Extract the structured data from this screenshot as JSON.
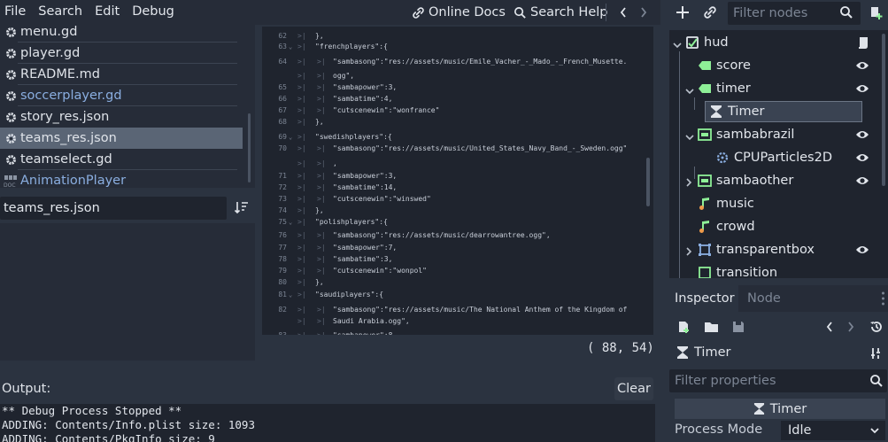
{
  "menu": {
    "file": "File",
    "search": "Search",
    "edit": "Edit",
    "debug": "Debug",
    "online_docs": "Online Docs",
    "search_help": "Search Help"
  },
  "files": [
    {
      "name": "menu.gd",
      "type": "script",
      "link": false
    },
    {
      "name": "player.gd",
      "type": "script",
      "link": false
    },
    {
      "name": "README.md",
      "type": "text",
      "link": false
    },
    {
      "name": "soccerplayer.gd",
      "type": "script",
      "link": true
    },
    {
      "name": "story_res.json",
      "type": "script",
      "link": false
    },
    {
      "name": "teams_res.json",
      "type": "script",
      "link": false,
      "selected": true
    },
    {
      "name": "teamselect.gd",
      "type": "script",
      "link": false
    },
    {
      "name": "AnimationPlayer",
      "type": "doc",
      "link": true
    }
  ],
  "current_file": "teams_res.json",
  "code_lines": [
    {
      "n": "62",
      "fold": "",
      "indent": 0,
      "text": "},"
    },
    {
      "n": "63",
      "fold": "v",
      "indent": 0,
      "text": "\"frenchplayers\":{"
    },
    {
      "n": "64",
      "fold": "",
      "indent": 1,
      "text": "\"sambasong\":\"res://assets/music/Emile_Vacher_-_Mado_-_French_Musette."
    },
    {
      "n": "",
      "fold": "",
      "indent": 1,
      "text": "ogg\","
    },
    {
      "n": "65",
      "fold": "",
      "indent": 1,
      "text": "\"sambapower\":3,"
    },
    {
      "n": "66",
      "fold": "",
      "indent": 1,
      "text": "\"sambatime\":4,"
    },
    {
      "n": "67",
      "fold": "",
      "indent": 1,
      "text": "\"cutscenewin\":\"wonfrance\""
    },
    {
      "n": "68",
      "fold": "",
      "indent": 0,
      "text": "},"
    },
    {
      "n": "69",
      "fold": "v",
      "indent": 0,
      "text": "\"swedishplayers\":{"
    },
    {
      "n": "70",
      "fold": "",
      "indent": 1,
      "text": "\"sambasong\":\"res://assets/music/United_States_Navy_Band_-_Sweden.ogg\""
    },
    {
      "n": "",
      "fold": "",
      "indent": 1,
      "text": ","
    },
    {
      "n": "71",
      "fold": "",
      "indent": 1,
      "text": "\"sambapower\":3,"
    },
    {
      "n": "72",
      "fold": "",
      "indent": 1,
      "text": "\"sambatime\":14,"
    },
    {
      "n": "73",
      "fold": "",
      "indent": 1,
      "text": "\"cutscenewin\":\"winswed\""
    },
    {
      "n": "74",
      "fold": "",
      "indent": 0,
      "text": "},"
    },
    {
      "n": "75",
      "fold": "v",
      "indent": 0,
      "text": "\"polishplayers\":{"
    },
    {
      "n": "76",
      "fold": "",
      "indent": 1,
      "text": "\"sambasong\":\"res://assets/music/dearrowantree.ogg\","
    },
    {
      "n": "77",
      "fold": "",
      "indent": 1,
      "text": "\"sambapower\":7,"
    },
    {
      "n": "78",
      "fold": "",
      "indent": 1,
      "text": "\"sambatime\":3,"
    },
    {
      "n": "79",
      "fold": "",
      "indent": 1,
      "text": "\"cutscenewin\":\"wonpol\""
    },
    {
      "n": "80",
      "fold": "",
      "indent": 0,
      "text": "},"
    },
    {
      "n": "81",
      "fold": "v",
      "indent": 0,
      "text": "\"saudiplayers\":{"
    },
    {
      "n": "82",
      "fold": "",
      "indent": 1,
      "text": "\"sambasong\":\"res://assets/music/The National Anthem of the Kingdom of"
    },
    {
      "n": "",
      "fold": "",
      "indent": 1,
      "text": "Saudi Arabia.ogg\","
    },
    {
      "n": "83",
      "fold": "",
      "indent": 1,
      "text": "\"sambapower\":8,"
    }
  ],
  "cursor_position": "( 88, 54)",
  "output": {
    "label": "Output:",
    "clear": "Clear",
    "lines": [
      "** Debug Process Stopped **",
      "ADDING: Contents/Info.plist size: 1093",
      "ADDING: Contents/PkgInfo size: 9"
    ]
  },
  "scene": {
    "filter_placeholder": "Filter nodes",
    "nodes": [
      {
        "name": "hud",
        "depth": 0,
        "icon": "control-icon",
        "expand": "v",
        "eye": false,
        "script": true
      },
      {
        "name": "score",
        "depth": 1,
        "icon": "label-icon",
        "expand": "",
        "eye": true
      },
      {
        "name": "timer",
        "depth": 1,
        "icon": "label-icon",
        "expand": "v",
        "eye": true
      },
      {
        "name": "Timer",
        "depth": 2,
        "icon": "timer-icon",
        "expand": "",
        "eye": false,
        "selected": true
      },
      {
        "name": "sambabrazil",
        "depth": 1,
        "icon": "panel-icon",
        "expand": "v",
        "eye": true
      },
      {
        "name": "CPUParticles2D",
        "depth": 2,
        "icon": "particles-icon",
        "expand": "",
        "eye": true
      },
      {
        "name": "sambaother",
        "depth": 1,
        "icon": "panel-icon",
        "expand": ">",
        "eye": true
      },
      {
        "name": "music",
        "depth": 1,
        "icon": "audio-icon",
        "expand": "",
        "eye": false
      },
      {
        "name": "crowd",
        "depth": 1,
        "icon": "audio-icon",
        "expand": "",
        "eye": false
      },
      {
        "name": "transparentbox",
        "depth": 1,
        "icon": "rect-icon",
        "expand": ">",
        "eye": true
      },
      {
        "name": "transition",
        "depth": 1,
        "icon": "texture-icon",
        "expand": "",
        "eye": false
      }
    ]
  },
  "inspector": {
    "tab_inspector": "Inspector",
    "tab_node": "Node",
    "object_name": "Timer",
    "filter_placeholder": "Filter properties",
    "class_name": "Timer",
    "process_mode_label": "Process Mode",
    "process_mode_value": "Idle"
  },
  "colors": {
    "accent_green": "#8eef97",
    "link_blue": "#8aaee0",
    "audio_orange": "#ef9a4a"
  }
}
